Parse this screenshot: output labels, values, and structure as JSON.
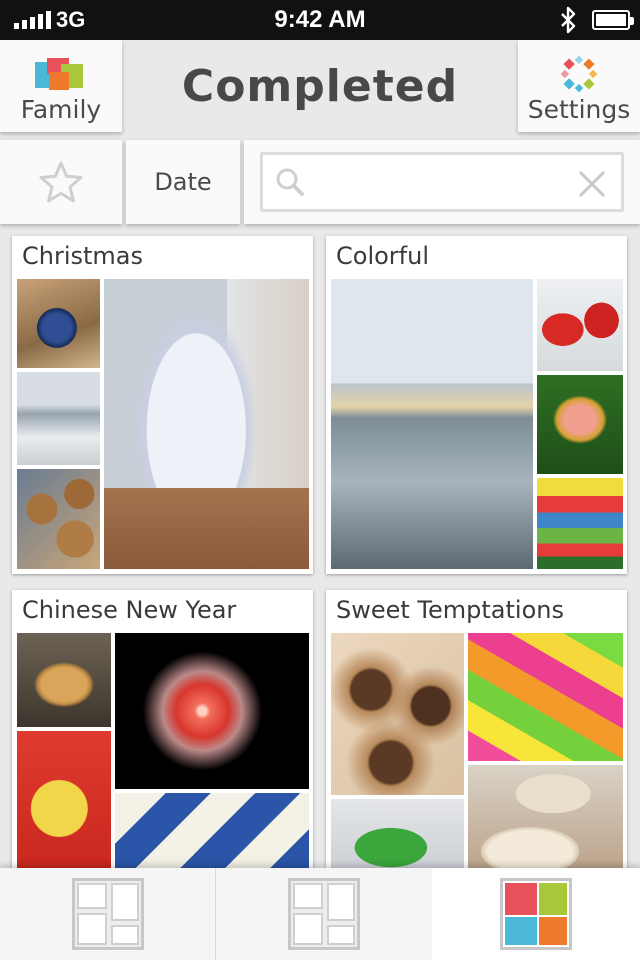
{
  "status_bar": {
    "carrier": "3G",
    "time": "9:42 AM"
  },
  "header": {
    "title": "Completed",
    "left_button": {
      "label": "Family",
      "icon": "family-icon"
    },
    "right_button": {
      "label": "Settings",
      "icon": "settings-icon"
    }
  },
  "filters": {
    "favorite_icon": "star-icon",
    "sort_label": "Date",
    "search": {
      "value": "",
      "placeholder": ""
    }
  },
  "albums": [
    {
      "title": "Christmas"
    },
    {
      "title": "Colorful"
    },
    {
      "title": "Chinese New Year"
    },
    {
      "title": "Sweet Temptations"
    }
  ],
  "tab_bar": {
    "tabs": [
      {
        "icon": "layout-grid-icon"
      },
      {
        "icon": "layout-grid-icon"
      },
      {
        "icon": "color-grid-icon",
        "active": true
      }
    ]
  },
  "colors": {
    "status_bar": "#111111",
    "accent_red": "#e8505b",
    "accent_green": "#a8c83a",
    "accent_blue": "#4cb8d8",
    "accent_orange": "#ef7a2e"
  }
}
